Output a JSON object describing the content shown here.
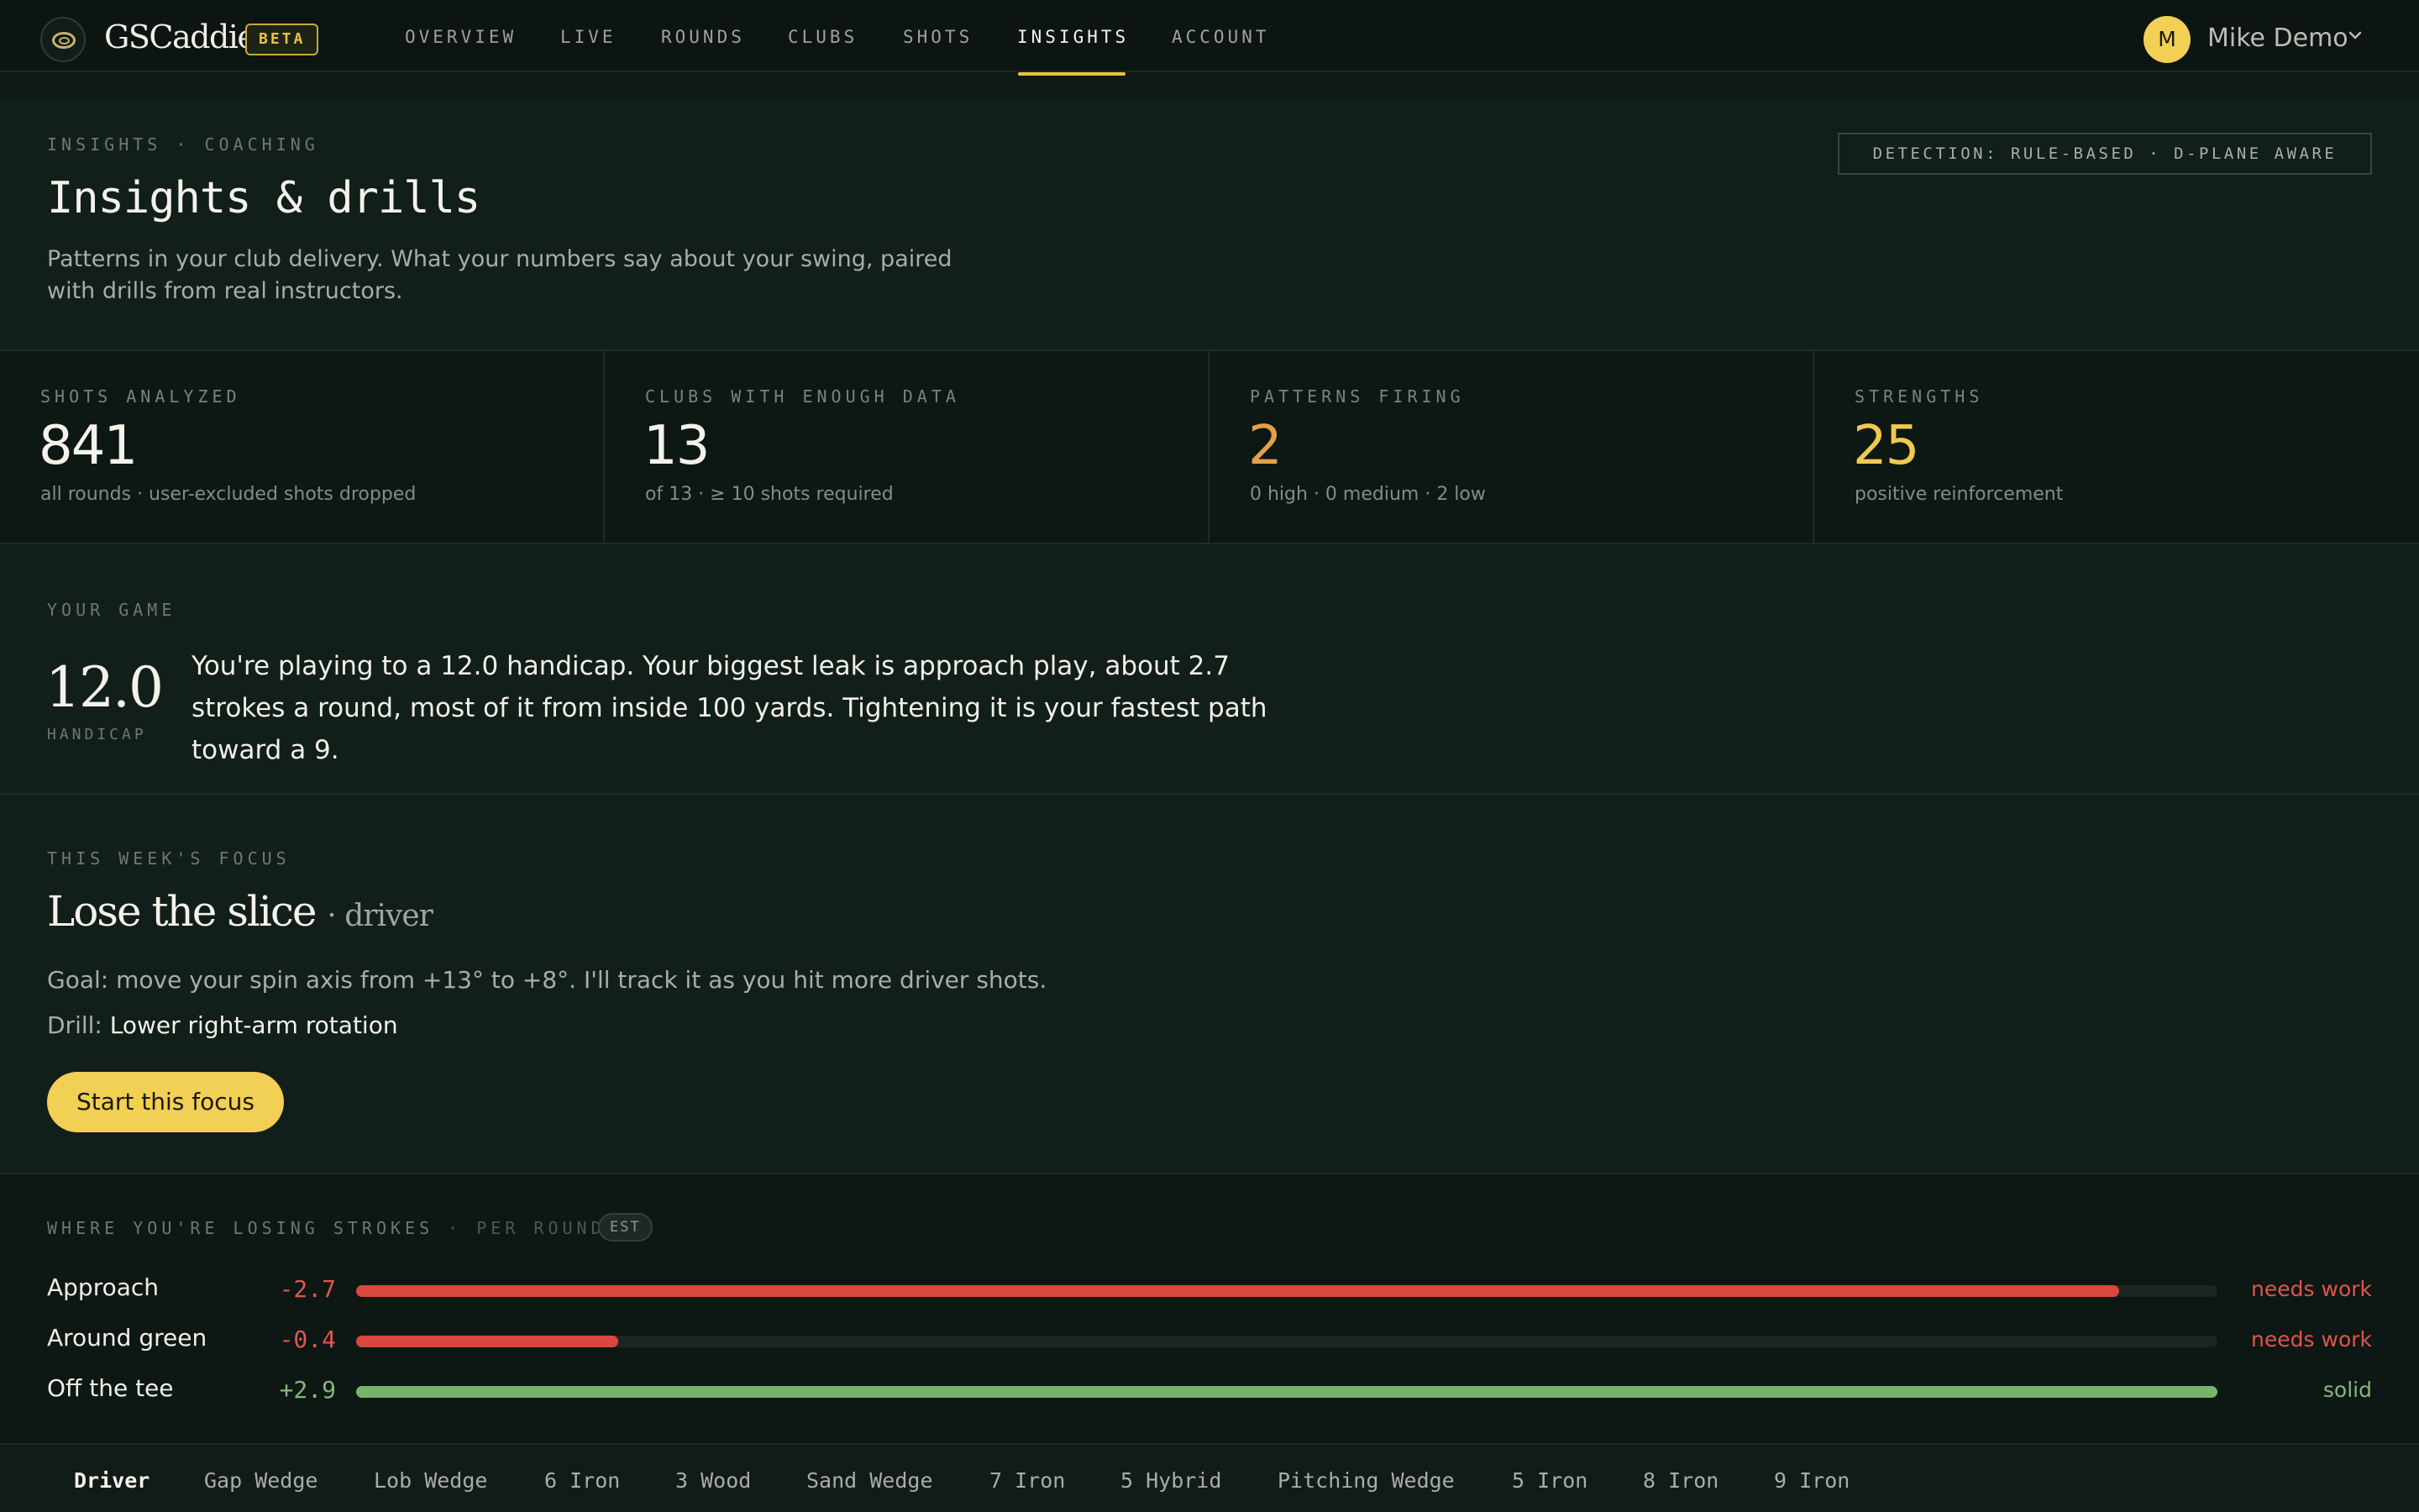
{
  "brand": {
    "name": "GSCaddie",
    "badge": "BETA"
  },
  "nav": {
    "links": [
      "OVERVIEW",
      "LIVE",
      "ROUNDS",
      "CLUBS",
      "SHOTS",
      "INSIGHTS",
      "ACCOUNT"
    ],
    "active": "INSIGHTS"
  },
  "user": {
    "initial": "M",
    "name": "Mike Demo"
  },
  "header": {
    "eyebrow": "INSIGHTS · COACHING",
    "title": "Insights & drills",
    "description": "Patterns in your club delivery. What your numbers say about your swing, paired with drills from real instructors.",
    "detection_badge": "DETECTION: RULE-BASED · D-PLANE AWARE"
  },
  "stats": [
    {
      "label": "SHOTS ANALYZED",
      "value": "841",
      "sub": "all rounds · user-excluded shots dropped",
      "color": "#f4f2ea"
    },
    {
      "label": "CLUBS WITH ENOUGH DATA",
      "value": "13",
      "sub": "of 13 · ≥ 10 shots required",
      "color": "#f4f2ea"
    },
    {
      "label": "PATTERNS FIRING",
      "value": "2",
      "sub": "0 high · 0 medium · 2 low",
      "color": "#e3a048"
    },
    {
      "label": "STRENGTHS",
      "value": "25",
      "sub": "positive reinforcement",
      "color": "#f0c94e"
    }
  ],
  "your_game": {
    "eyebrow": "YOUR GAME",
    "handicap": "12.0",
    "handicap_label": "HANDICAP",
    "summary": "You're playing to a 12.0 handicap. Your biggest leak is approach play, about 2.7 strokes a round, most of it from inside 100 yards. Tightening it is your fastest path toward a 9."
  },
  "focus": {
    "eyebrow": "THIS WEEK'S FOCUS",
    "title": "Lose the slice",
    "club": "· driver",
    "goal": "Goal: move your spin axis from +13° to +8°. I'll track it as you hit more driver shots.",
    "drill_prefix": "Drill:",
    "drill_name": "Lower right-arm rotation",
    "button": "Start this focus"
  },
  "strokes": {
    "eyebrow": "WHERE YOU'RE LOSING STROKES",
    "eyebrow_suffix": "· PER ROUND",
    "badge": "EST",
    "rows": [
      {
        "category": "Approach",
        "value": "-2.7",
        "fill": 0.947,
        "status": "needs work",
        "tone": "bad"
      },
      {
        "category": "Around green",
        "value": "-0.4",
        "fill": 0.141,
        "status": "needs work",
        "tone": "bad"
      },
      {
        "category": "Off the tee",
        "value": "+2.9",
        "fill": 1.0,
        "status": "solid",
        "tone": "good"
      }
    ]
  },
  "club_tabs": {
    "items": [
      "Driver",
      "Gap Wedge",
      "Lob Wedge",
      "6 Iron",
      "3 Wood",
      "Sand Wedge",
      "7 Iron",
      "5 Hybrid",
      "Pitching Wedge",
      "5 Iron",
      "8 Iron",
      "9 Iron"
    ],
    "active": "Driver"
  },
  "colors": {
    "accent": "#f2cf55",
    "bad": "#d9473f",
    "good": "#79b36b",
    "orange": "#e3a048"
  }
}
